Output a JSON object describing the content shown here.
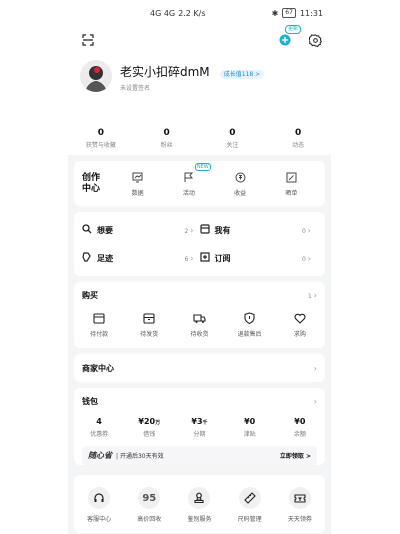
{
  "status_bar": {
    "left_text": "4G 4G",
    "speed": "2.2 K/s",
    "battery": "67",
    "time": "11:31"
  },
  "topbar": {
    "new_tag": "更新"
  },
  "profile": {
    "username": "老实小扣碎dmM",
    "level_badge": "成长值118 >",
    "signature": "未设置签名"
  },
  "stats": [
    {
      "value": "0",
      "label": "获赞与收藏"
    },
    {
      "value": "0",
      "label": "粉丝"
    },
    {
      "value": "0",
      "label": "关注"
    },
    {
      "value": "0",
      "label": "动态"
    }
  ],
  "creator": {
    "title_line1": "创作",
    "title_line2": "中心",
    "new_badge": "NEW",
    "items": [
      {
        "label": "数据",
        "icon": "chart-icon"
      },
      {
        "label": "活动",
        "icon": "flag-icon"
      },
      {
        "label": "收益",
        "icon": "coin-icon"
      },
      {
        "label": "晒单",
        "icon": "edit-icon"
      }
    ]
  },
  "shortcuts": [
    {
      "label": "想要",
      "count": "2",
      "icon": "search-icon"
    },
    {
      "label": "我有",
      "count": "0",
      "icon": "box-icon"
    },
    {
      "label": "足迹",
      "count": "6",
      "icon": "footprint-icon"
    },
    {
      "label": "订阅",
      "count": "0",
      "icon": "plus-box-icon"
    }
  ],
  "purchase": {
    "title": "购买",
    "count": "1",
    "items": [
      {
        "label": "待付款",
        "icon": "wallet-icon"
      },
      {
        "label": "待发货",
        "icon": "package-icon"
      },
      {
        "label": "待收货",
        "icon": "truck-icon"
      },
      {
        "label": "退款售后",
        "icon": "shield-icon"
      },
      {
        "label": "求购",
        "icon": "heart-icon"
      }
    ]
  },
  "merchant": {
    "title": "商家中心"
  },
  "wallet": {
    "title": "钱包",
    "values": [
      {
        "value": "4",
        "unit": "",
        "label": "优惠券"
      },
      {
        "value": "¥20",
        "unit": "万",
        "label": "借钱"
      },
      {
        "value": "¥3",
        "unit": "千",
        "label": "分期"
      },
      {
        "value": "¥0",
        "unit": "",
        "label": "津贴"
      },
      {
        "value": "¥0",
        "unit": "",
        "label": "余额"
      }
    ],
    "promo_brand": "随心省",
    "promo_text": "开通后30天有效",
    "promo_action": "立即领取 >"
  },
  "services": [
    {
      "label": "客服中心",
      "icon": "headset-icon",
      "glyph": ""
    },
    {
      "label": "高价回收",
      "icon": "recycle-95-icon",
      "glyph": "95"
    },
    {
      "label": "鉴别服务",
      "icon": "stamp-icon",
      "glyph": ""
    },
    {
      "label": "尺码管理",
      "icon": "ruler-icon",
      "glyph": ""
    },
    {
      "label": "天天领券",
      "icon": "ticket-icon",
      "glyph": ""
    }
  ]
}
